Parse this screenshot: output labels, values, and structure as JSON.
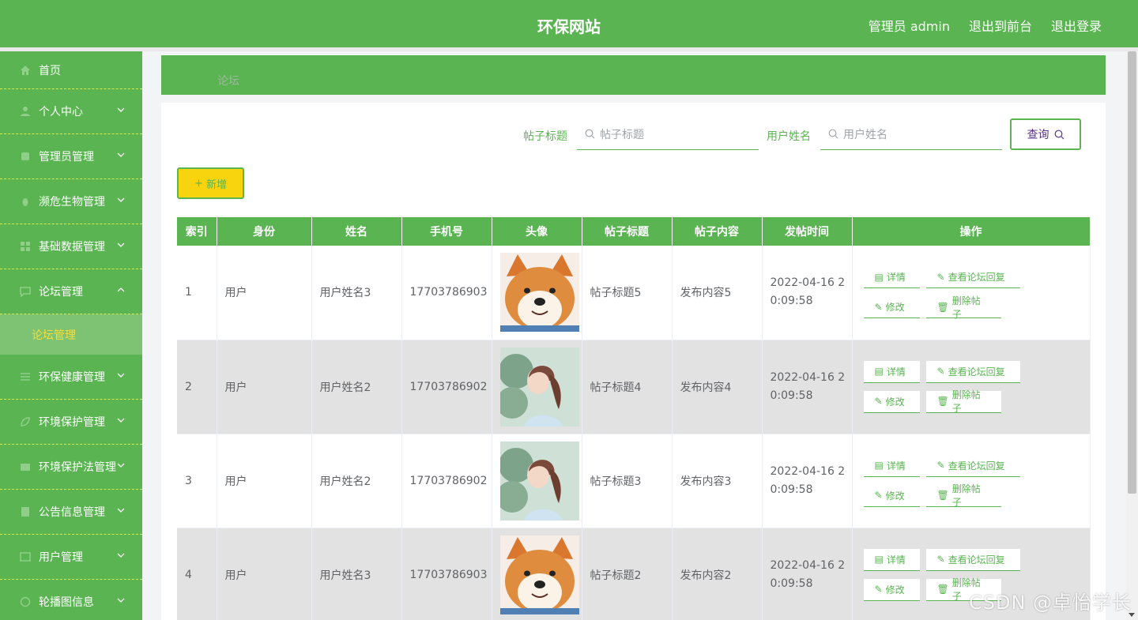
{
  "header": {
    "title": "环保网站",
    "user": "管理员 admin",
    "to_front": "退出到前台",
    "logout": "退出登录"
  },
  "sidebar": {
    "items": [
      {
        "label": "首页",
        "icon": "home-icon"
      },
      {
        "label": "个人中心",
        "icon": "user-icon"
      },
      {
        "label": "管理员管理",
        "icon": "db-icon"
      },
      {
        "label": "濒危生物管理",
        "icon": "bug-icon"
      },
      {
        "label": "基础数据管理",
        "icon": "grid-icon"
      },
      {
        "label": "论坛管理",
        "icon": "chat-icon"
      },
      {
        "label": "环保健康管理",
        "icon": "list-icon"
      },
      {
        "label": "环境保护管理",
        "icon": "leaf-icon"
      },
      {
        "label": "环境保护法管理",
        "icon": "book-icon"
      },
      {
        "label": "公告信息管理",
        "icon": "notice-icon"
      },
      {
        "label": "用户管理",
        "icon": "users-icon"
      },
      {
        "label": "轮播图信息",
        "icon": "image-icon"
      }
    ],
    "active_sub": "论坛管理"
  },
  "breadcrumb": "论坛",
  "search": {
    "title_label": "帖子标题",
    "title_placeholder": "帖子标题",
    "name_label": "用户姓名",
    "name_placeholder": "用户姓名",
    "query_label": "查询"
  },
  "add_label": "新增",
  "table": {
    "headers": [
      "索引",
      "身份",
      "姓名",
      "手机号",
      "头像",
      "帖子标题",
      "帖子内容",
      "发帖时间",
      "操作"
    ],
    "rows": [
      {
        "index": "1",
        "identity": "用户",
        "name": "用户姓名3",
        "phone": "17703786903",
        "avatar": "dog",
        "title": "帖子标题5",
        "content": "发布内容5",
        "time": "2022-04-16 20:09:58"
      },
      {
        "index": "2",
        "identity": "用户",
        "name": "用户姓名2",
        "phone": "17703786902",
        "avatar": "girl",
        "title": "帖子标题4",
        "content": "发布内容4",
        "time": "2022-04-16 20:09:58"
      },
      {
        "index": "3",
        "identity": "用户",
        "name": "用户姓名2",
        "phone": "17703786902",
        "avatar": "girl",
        "title": "帖子标题3",
        "content": "发布内容3",
        "time": "2022-04-16 20:09:58"
      },
      {
        "index": "4",
        "identity": "用户",
        "name": "用户姓名3",
        "phone": "17703786903",
        "avatar": "dog",
        "title": "帖子标题2",
        "content": "发布内容2",
        "time": "2022-04-16 20:09:58"
      }
    ],
    "ops": {
      "detail": "详情",
      "replies": "查看论坛回复",
      "edit": "修改",
      "delete": "删除帖子"
    }
  },
  "watermark": "CSDN @卓怡学长",
  "colors": {
    "primary": "#59b451",
    "accent": "#f7d40d",
    "stripe": "#e3e2e2"
  }
}
